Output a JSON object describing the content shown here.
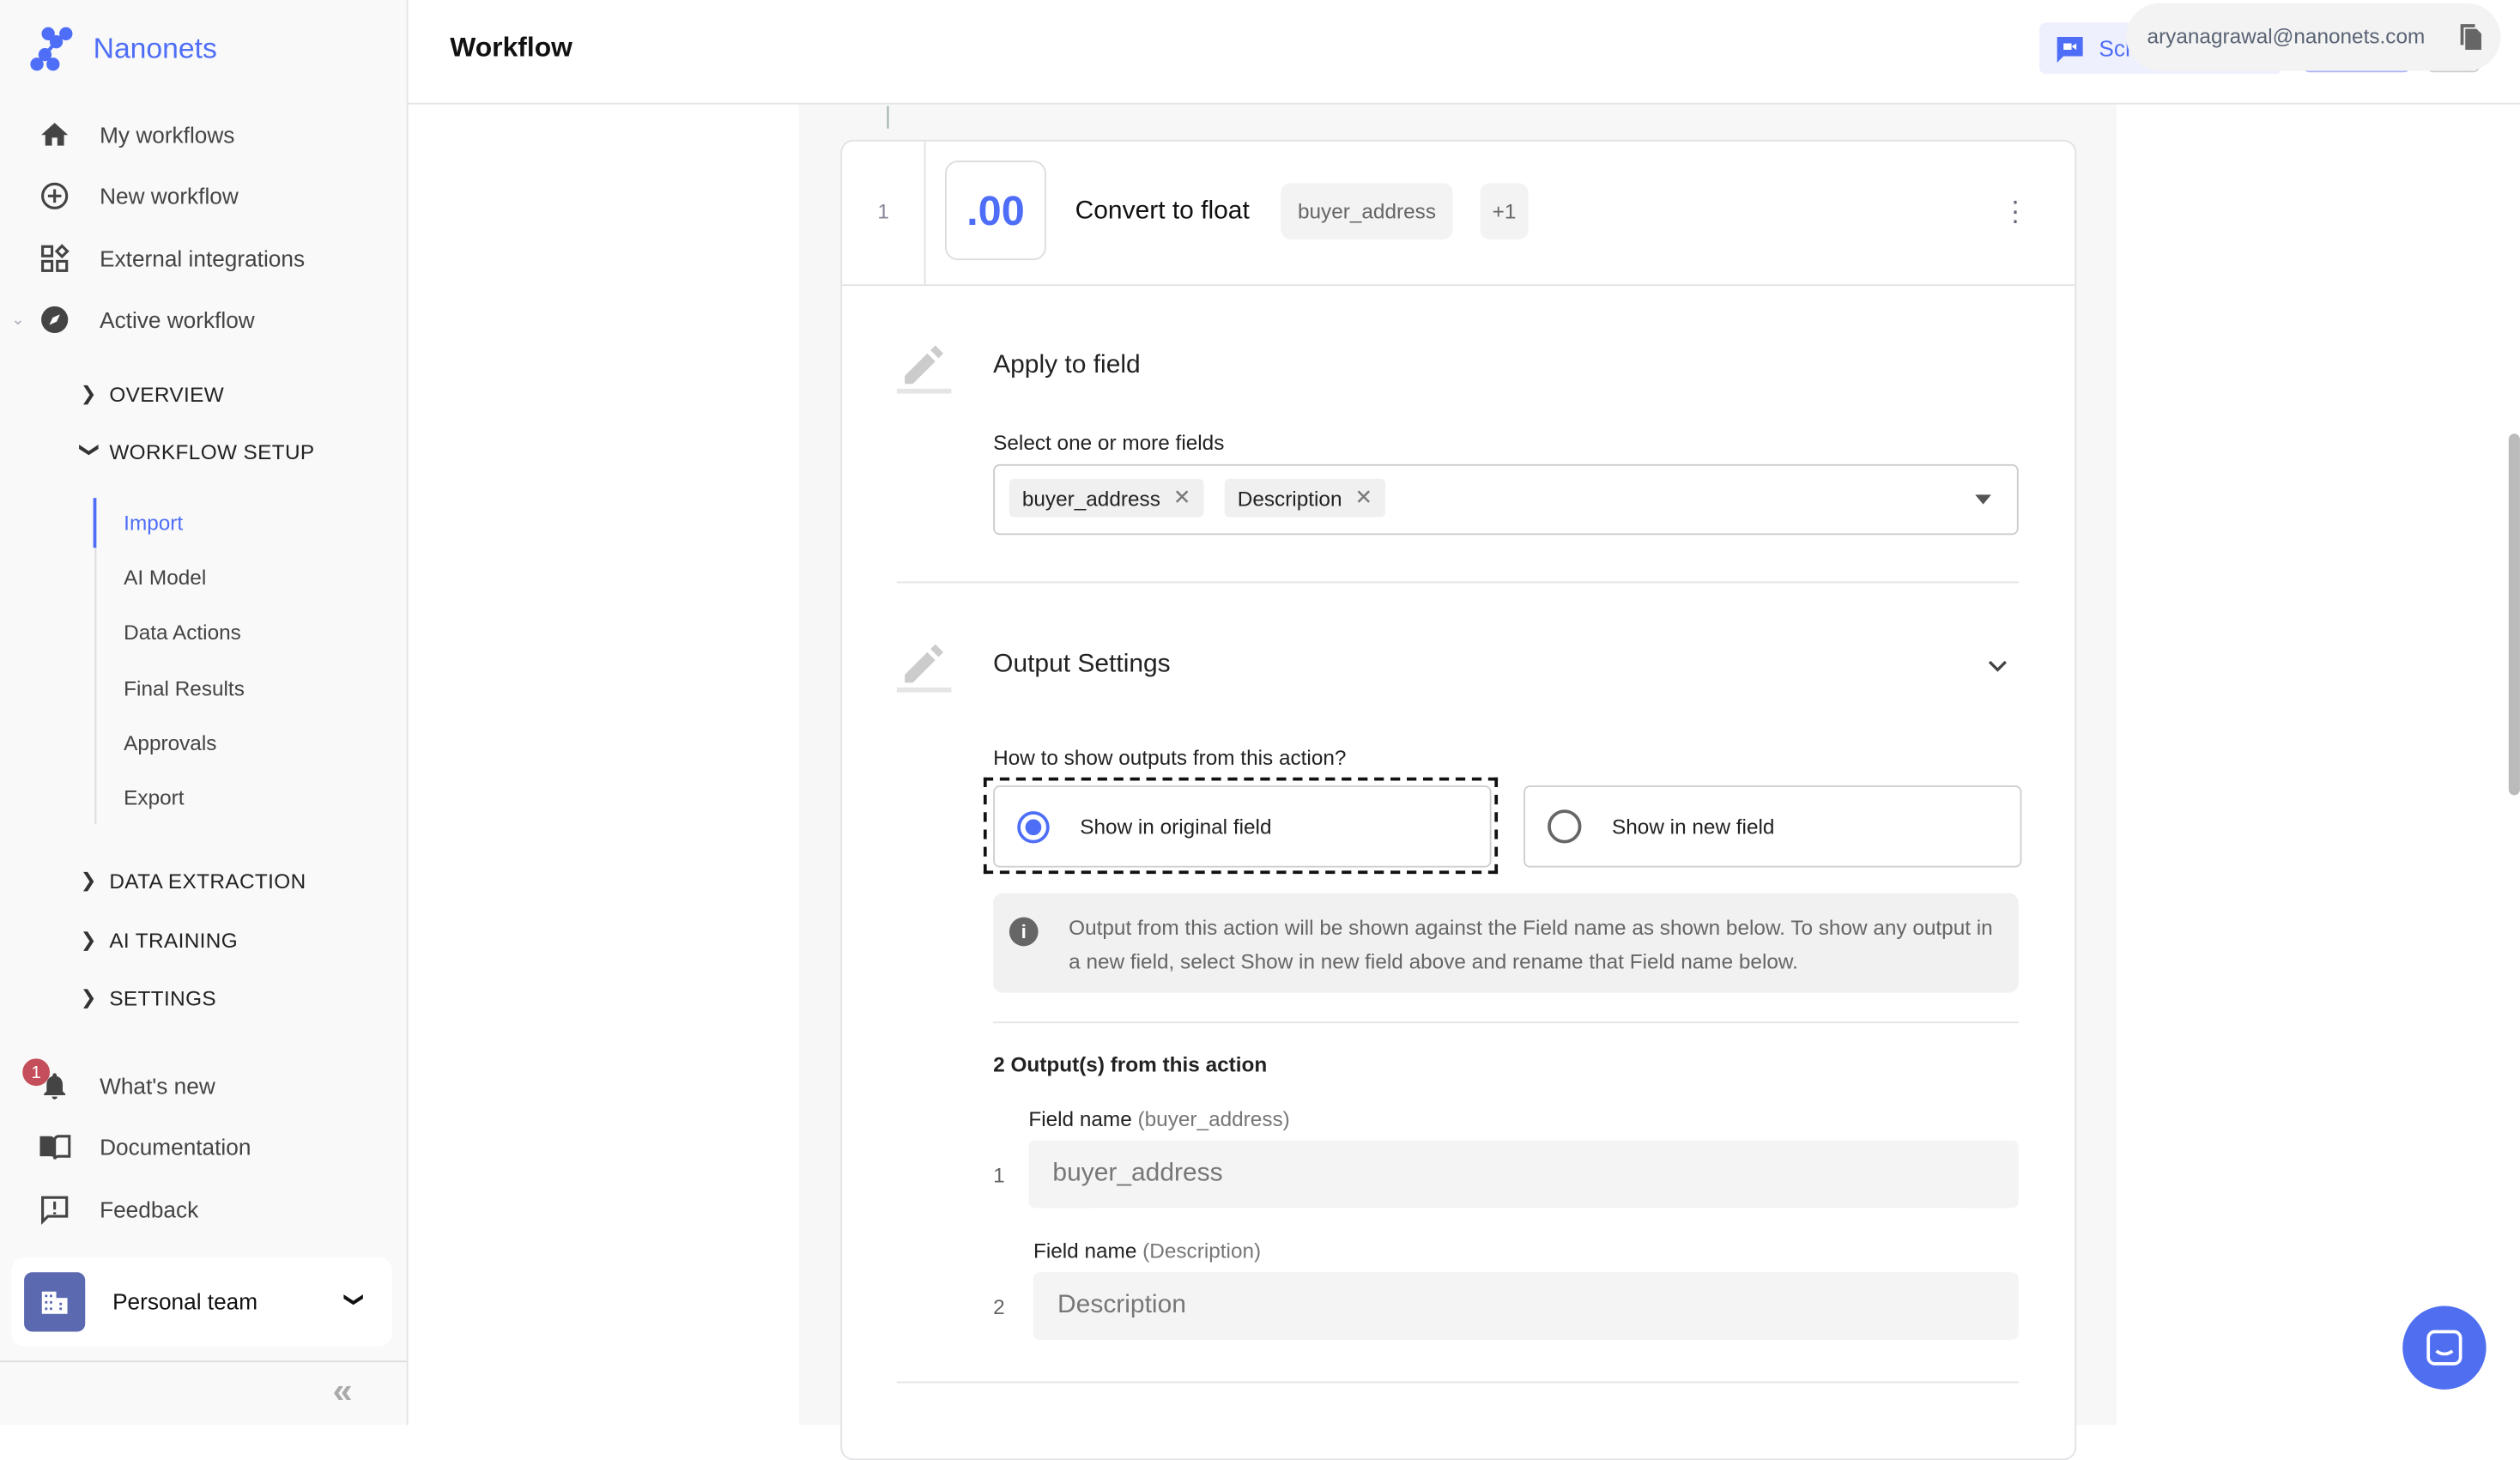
{
  "app": {
    "brand": "Nanonets",
    "page_title": "Workflow",
    "accent": "#4f6ef7"
  },
  "sidebar": {
    "main_items": [
      {
        "label": "My workflows",
        "icon": "home-icon"
      },
      {
        "label": "New workflow",
        "icon": "plus-circle-icon"
      },
      {
        "label": "External integrations",
        "icon": "widgets-icon"
      },
      {
        "label": "Active workflow",
        "icon": "compass-icon"
      }
    ],
    "sections": [
      {
        "label": "OVERVIEW",
        "expanded": false
      },
      {
        "label": "WORKFLOW SETUP",
        "expanded": true
      },
      {
        "label": "DATA EXTRACTION",
        "expanded": false
      },
      {
        "label": "AI TRAINING",
        "expanded": false
      },
      {
        "label": "SETTINGS",
        "expanded": false
      }
    ],
    "setup_items": [
      {
        "label": "Import",
        "active": true
      },
      {
        "label": "AI Model"
      },
      {
        "label": "Data Actions"
      },
      {
        "label": "Final Results"
      },
      {
        "label": "Approvals"
      },
      {
        "label": "Export"
      }
    ],
    "bottom_items": [
      {
        "label": "What's new",
        "icon": "bell-icon",
        "badge": "1"
      },
      {
        "label": "Documentation",
        "icon": "book-icon"
      },
      {
        "label": "Feedback",
        "icon": "feedback-icon"
      }
    ],
    "team": {
      "label": "Personal team"
    }
  },
  "header": {
    "schedule_label": "Sch",
    "email": "aryanagrawal@nanonets.com"
  },
  "action": {
    "index": "1",
    "icon_text": ".00",
    "title": "Convert to float",
    "field_chip": "buyer_address",
    "more_chip": "+1",
    "apply": {
      "title": "Apply to field",
      "select_label": "Select one or more fields",
      "selected": [
        "buyer_address",
        "Description"
      ]
    },
    "output": {
      "title": "Output Settings",
      "question": "How to show outputs from this action?",
      "options": [
        {
          "label": "Show in original field",
          "selected": true
        },
        {
          "label": "Show in new field",
          "selected": false
        }
      ],
      "info": "Output from this action will be shown against the Field name as shown below. To show any output in a new field, select Show in new field above and rename that Field name below.",
      "count_label": "2 Output(s) from this action",
      "fields": [
        {
          "index": "1",
          "label": "Field name",
          "source": "(buyer_address)",
          "value": "buyer_address"
        },
        {
          "index": "2",
          "label": "Field name",
          "source": "(Description)",
          "value": "Description"
        }
      ]
    }
  }
}
